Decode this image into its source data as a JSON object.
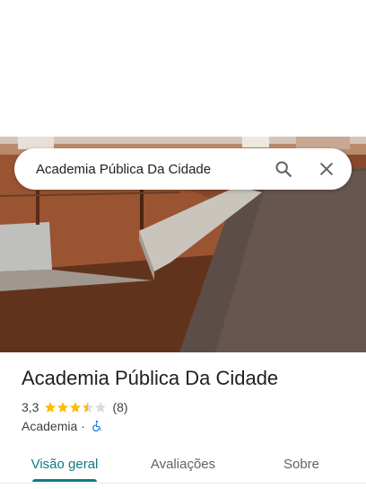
{
  "search": {
    "query": "Academia Pública Da Cidade"
  },
  "place": {
    "name": "Academia Pública Da Cidade",
    "rating": "3,3",
    "rating_value": 3.3,
    "review_count": "(8)",
    "category": "Academia",
    "separator": "·"
  },
  "tabs": [
    {
      "label": "Visão geral",
      "active": true
    },
    {
      "label": "Avaliações",
      "active": false
    },
    {
      "label": "Sobre",
      "active": false
    }
  ],
  "icons": {
    "search": "search-icon",
    "close": "close-icon",
    "accessibility": "wheelchair-icon"
  },
  "colors": {
    "accent": "#0e7b80",
    "star": "#fbbc04",
    "star_empty": "#dadce0",
    "accessible": "#1a73e8"
  }
}
